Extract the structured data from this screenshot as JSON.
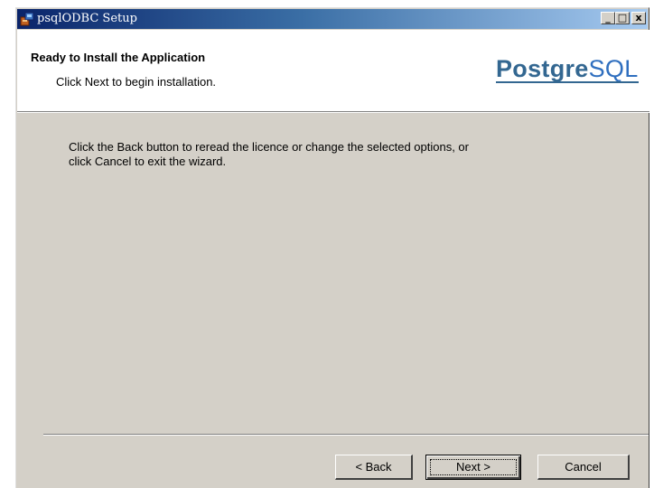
{
  "window": {
    "title": "psqlODBC Setup",
    "controls": {
      "minimize": "_",
      "maximize": "□",
      "close": "x"
    }
  },
  "header": {
    "title": "Ready to Install the Application",
    "subtitle": "Click Next to begin installation.",
    "logo": {
      "part1": "Postgre",
      "part2": "SQL"
    }
  },
  "body": {
    "line1": "Click the Back button to reread the licence or change the selected options,  or",
    "line2": "click Cancel to exit the wizard."
  },
  "buttons": {
    "back": "< Back",
    "next": "Next >",
    "cancel": "Cancel"
  },
  "colors": {
    "title_gradient_start": "#0a246a",
    "title_gradient_end": "#a6caf0",
    "dialog_face": "#d4d0c8",
    "logo": "#336791"
  },
  "icons": [
    "app-installer-icon"
  ]
}
